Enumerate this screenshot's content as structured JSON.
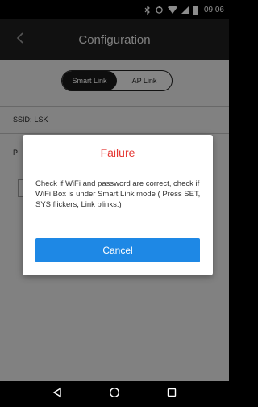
{
  "status_bar": {
    "time": "09:06",
    "icons": [
      "bluetooth-icon",
      "sync-icon",
      "wifi-icon",
      "signal-icon",
      "battery-icon"
    ]
  },
  "app_bar": {
    "title": "Configuration",
    "back_icon": "chevron-left-icon"
  },
  "mode_toggle": {
    "options": [
      "Smart Link",
      "AP Link"
    ],
    "selected": "Smart Link"
  },
  "form": {
    "ssid_label": "SSID:",
    "ssid_value": "LSK",
    "password_label": "P"
  },
  "dialog": {
    "title": "Failure",
    "message": "Check if WiFi and password are correct, check if WiFi Box is under Smart Link mode ( Press SET, SYS flickers, Link blinks.)",
    "cancel_label": "Cancel"
  },
  "nav_bar": {
    "buttons": [
      "back-icon",
      "home-icon",
      "recents-icon"
    ]
  },
  "colors": {
    "accent": "#1e88e5",
    "error": "#e53935",
    "app_bar": "#1f1f1f"
  }
}
